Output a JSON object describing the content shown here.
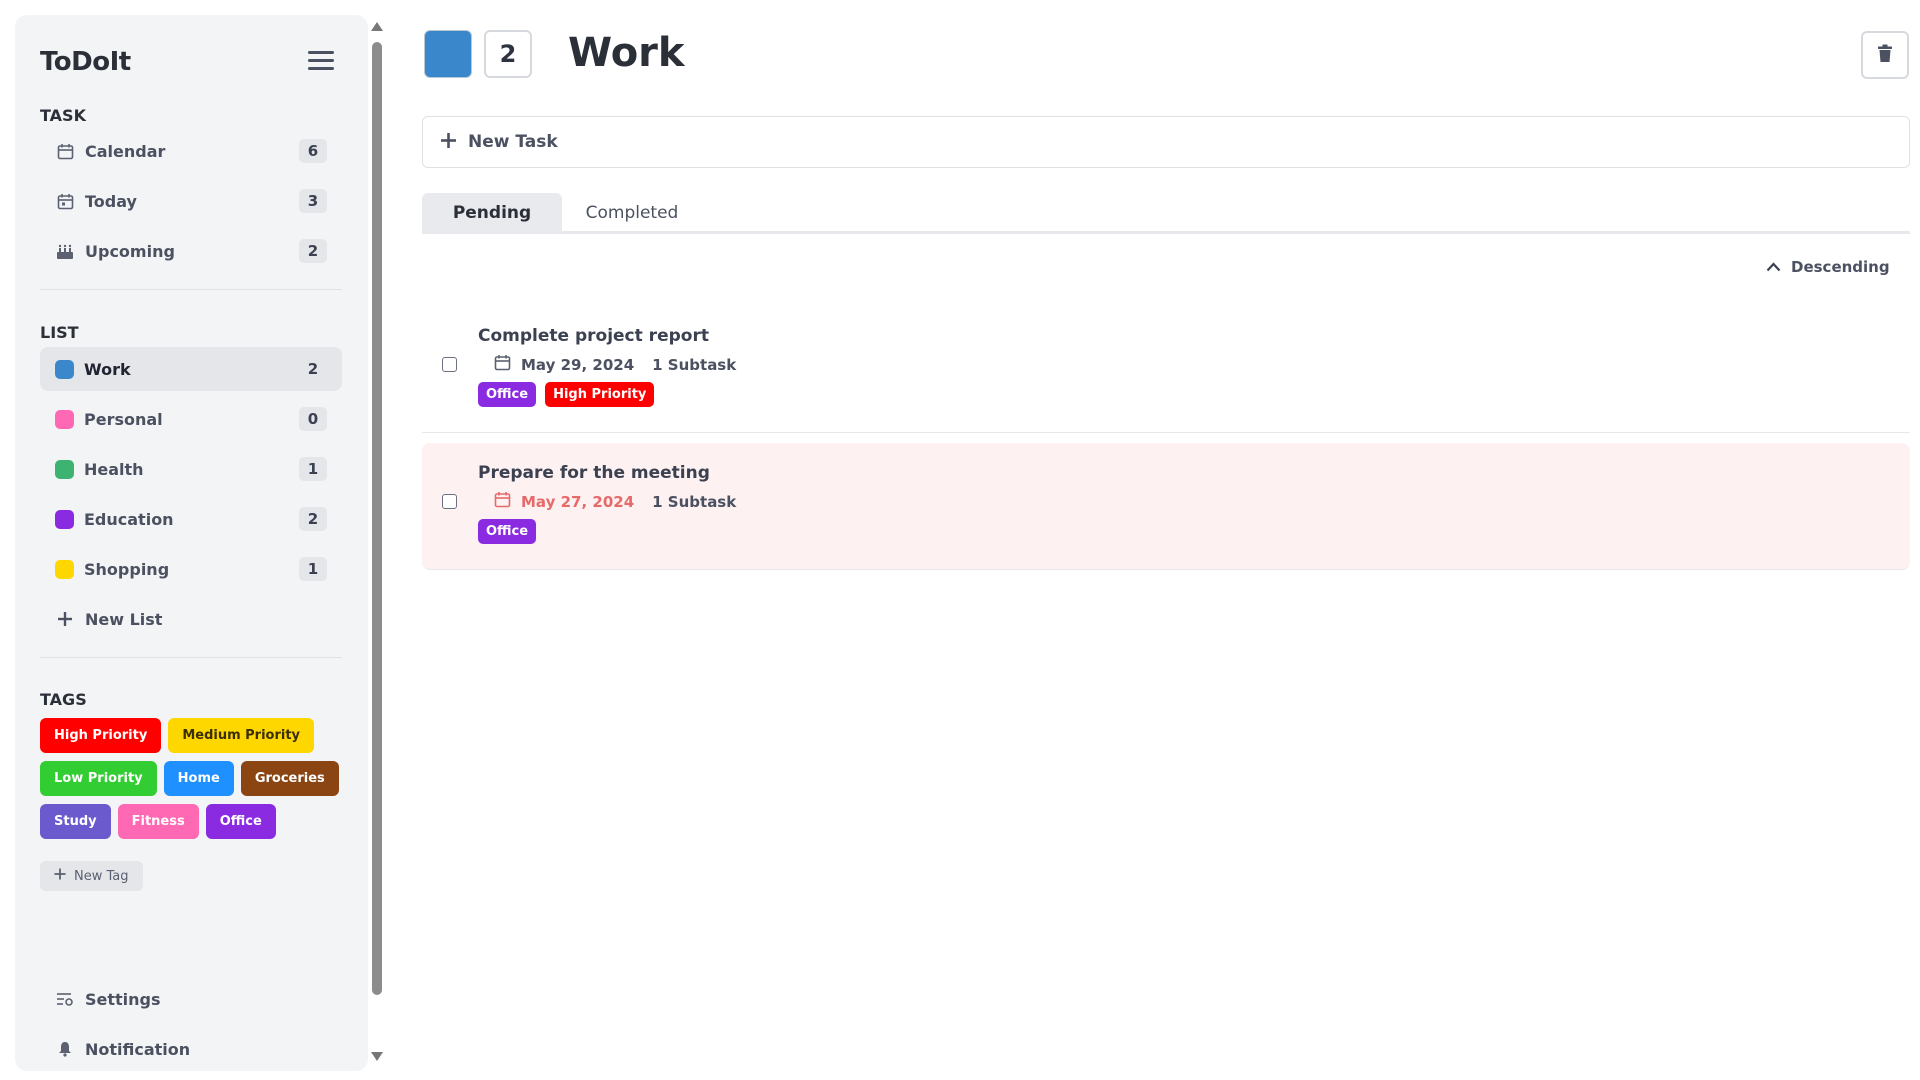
{
  "sidebar": {
    "brand": "ToDoIt",
    "task_section": "TASK",
    "task_items": [
      {
        "label": "Calendar",
        "count": "6",
        "icon": "calendar-icon"
      },
      {
        "label": "Today",
        "count": "3",
        "icon": "today-icon"
      },
      {
        "label": "Upcoming",
        "count": "2",
        "icon": "upcoming-icon"
      }
    ],
    "list_section": "LIST",
    "lists": [
      {
        "label": "Work",
        "count": "2",
        "color": "#3a87cb"
      },
      {
        "label": "Personal",
        "count": "0",
        "color": "#ff69b4"
      },
      {
        "label": "Health",
        "count": "1",
        "color": "#3cb371"
      },
      {
        "label": "Education",
        "count": "2",
        "color": "#8a2be2"
      },
      {
        "label": "Shopping",
        "count": "1",
        "color": "#ffd700"
      }
    ],
    "new_list": "New List",
    "tags_section": "TAGS",
    "tags": [
      {
        "label": "High Priority",
        "color": "#ff0000"
      },
      {
        "label": "Medium Priority",
        "color": "#ffd700"
      },
      {
        "label": "Low Priority",
        "color": "#32cd32"
      },
      {
        "label": "Home",
        "color": "#1e90ff"
      },
      {
        "label": "Groceries",
        "color": "#8b4513"
      },
      {
        "label": "Study",
        "color": "#6a5acd"
      },
      {
        "label": "Fitness",
        "color": "#ff69b4"
      },
      {
        "label": "Office",
        "color": "#8a2be2"
      }
    ],
    "new_tag": "New Tag",
    "settings": "Settings",
    "notification": "Notification"
  },
  "main": {
    "list_color": "#3a87cb",
    "count": "2",
    "title": "Work",
    "new_task": "New Task",
    "tabs": [
      "Pending",
      "Completed"
    ],
    "sort_label": "Descending",
    "tasks": [
      {
        "title": "Complete project report",
        "date": "May 29, 2024",
        "subtasks": "1 Subtask",
        "tags": [
          {
            "label": "Office",
            "color": "#8a2be2"
          },
          {
            "label": "High Priority",
            "color": "#ff0000"
          }
        ],
        "overdue": false
      },
      {
        "title": "Prepare for the meeting",
        "date": "May 27, 2024",
        "subtasks": "1 Subtask",
        "tags": [
          {
            "label": "Office",
            "color": "#8a2be2"
          }
        ],
        "overdue": true
      }
    ]
  }
}
